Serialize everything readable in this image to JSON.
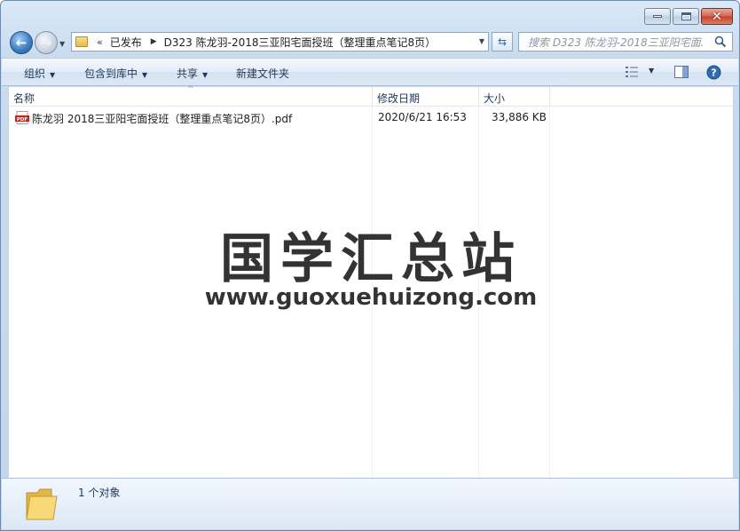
{
  "window": {
    "buttons": {
      "minimize": "minimize",
      "maximize": "maximize",
      "close": "close"
    }
  },
  "nav": {
    "back_icon": "back-arrow-icon",
    "forward_icon": "forward-arrow-icon",
    "address": {
      "chevron": "«",
      "crumbs": [
        "已发布",
        "D323 陈龙羽-2018三亚阳宅面授班（整理重点笔记8页）"
      ],
      "separator": "▶"
    },
    "search": {
      "placeholder": "搜索 D323 陈龙羽-2018三亚阳宅面..."
    }
  },
  "toolbar": {
    "organize": "组织",
    "include_in_library": "包含到库中",
    "share": "共享",
    "new_folder": "新建文件夹"
  },
  "columns": {
    "name": "名称",
    "modified": "修改日期",
    "size": "大小"
  },
  "files": [
    {
      "name": "陈龙羽 2018三亚阳宅面授班（整理重点笔记8页）.pdf",
      "modified": "2020/6/21 16:53",
      "size": "33,886 KB",
      "icon": "pdf-file-icon"
    }
  ],
  "watermark": {
    "title": "国学汇总站",
    "url": "www.guoxuehuizong.com"
  },
  "status": {
    "count": "1 个对象"
  },
  "colors": {
    "accent": "#1e395b",
    "window_frame": "#c3d7ec",
    "close_button": "#c3422d"
  }
}
